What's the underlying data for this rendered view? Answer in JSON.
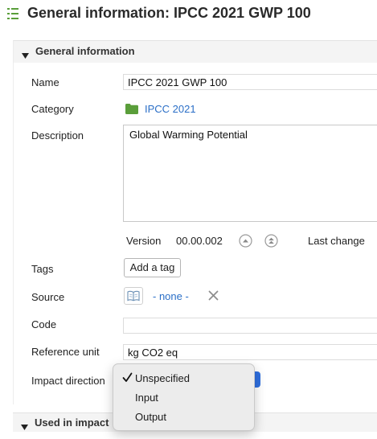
{
  "header": {
    "title": "General information: IPCC 2021 GWP 100",
    "icon": "list-icon"
  },
  "section": {
    "label": "General information"
  },
  "form": {
    "name_label": "Name",
    "name_value": "IPCC 2021 GWP 100",
    "category_label": "Category",
    "category_value": "IPCC 2021",
    "description_label": "Description",
    "description_value": "Global Warming Potential",
    "version_label": "Version",
    "version_value": "00.00.002",
    "last_change_label": "Last change",
    "tags_label": "Tags",
    "add_tag_label": "Add a tag",
    "source_label": "Source",
    "source_value": "- none -",
    "code_label": "Code",
    "code_value": "",
    "reference_unit_label": "Reference unit",
    "reference_unit_value": "kg CO2 eq",
    "impact_direction_label": "Impact direction"
  },
  "dropdown": {
    "options": [
      "Unspecified",
      "Input",
      "Output"
    ],
    "selected": "Unspecified"
  },
  "footer_section": {
    "label": "Used in impact"
  },
  "colors": {
    "link": "#2b6fc7",
    "folder": "#5a9e3a",
    "accent": "#2f6fe0"
  }
}
